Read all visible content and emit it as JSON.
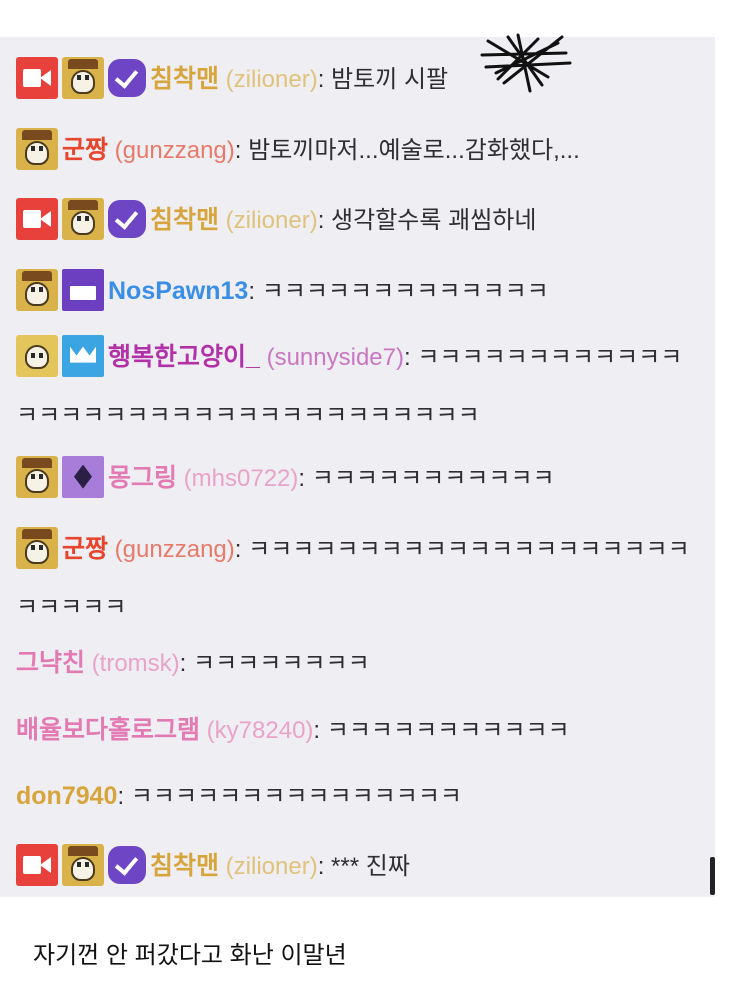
{
  "chat": {
    "messages": [
      {
        "badges": [
          "camera-icon",
          "skull-badge-icon",
          "verified-icon"
        ],
        "name": "침착맨",
        "login": "(zilioner)",
        "name_color": "#d8a53d",
        "text": "밤토끼 시팔",
        "sep": ": "
      },
      {
        "badges": [
          "skull-badge-icon"
        ],
        "name": "군짱",
        "login": "(gunzzang)",
        "name_color": "#e8452f",
        "login_color": "#e87a6a",
        "text": "밤토끼마저...예술로...감화했다,...",
        "sep": ": "
      },
      {
        "badges": [
          "camera-icon",
          "skull-badge-icon",
          "verified-icon"
        ],
        "name": "침착맨",
        "login": "(zilioner)",
        "name_color": "#d8a53d",
        "text": "생각할수록 괘씸하네",
        "sep": ": "
      },
      {
        "badges": [
          "skull-badge-icon",
          "subscriber-purple-icon"
        ],
        "name": "NosPawn13",
        "login": "",
        "name_color": "#3a8ee6",
        "text": "ㅋㅋㅋㅋㅋㅋㅋㅋㅋㅋㅋㅋㅋ",
        "sep": ": "
      },
      {
        "badges": [
          "skull-badge-icon",
          "crown-badge-icon"
        ],
        "name": "행복한고양이_",
        "login": "(sunnyside7)",
        "name_color": "#b331a8",
        "login_color": "#c977c2",
        "text": "ㅋㅋㅋㅋㅋㅋㅋㅋㅋㅋㅋㅋㅋㅋㅋㅋㅋㅋㅋㅋㅋㅋㅋㅋㅋㅋㅋㅋㅋㅋㅋㅋㅋ",
        "sep": ": "
      },
      {
        "badges": [
          "skull-badge-icon",
          "gem-badge-icon"
        ],
        "name": "몽그링",
        "login": "(mhs0722)",
        "name_color": "#e37ab3",
        "login_color": "#eaa3c8",
        "text": "ㅋㅋㅋㅋㅋㅋㅋㅋㅋㅋㅋ",
        "sep": ": "
      },
      {
        "badges": [
          "skull-badge-icon"
        ],
        "name": "군짱",
        "login": "(gunzzang)",
        "name_color": "#e8452f",
        "login_color": "#e87a6a",
        "text": "ㅋㅋㅋㅋㅋㅋㅋㅋㅋㅋㅋㅋㅋㅋㅋㅋㅋㅋㅋㅋㅋㅋㅋㅋㅋ",
        "sep": ": "
      },
      {
        "badges": [],
        "name": "그냑친",
        "login": "(tromsk)",
        "name_color": "#e37ab3",
        "login_color": "#eaa3c8",
        "text": "ㅋㅋㅋㅋㅋㅋㅋㅋ",
        "sep": ": "
      },
      {
        "badges": [],
        "name": "배율보다홀로그램",
        "login": "(ky78240)",
        "name_color": "#e37ab3",
        "login_color": "#eaa3c8",
        "text": "ㅋㅋㅋㅋㅋㅋㅋㅋㅋㅋㅋ",
        "sep": ": "
      },
      {
        "badges": [],
        "name": "don7940",
        "login": "",
        "name_color": "#d8a53d",
        "text": "ㅋㅋㅋㅋㅋㅋㅋㅋㅋㅋㅋㅋㅋㅋㅋ",
        "sep": ": "
      },
      {
        "badges": [
          "camera-icon",
          "skull-badge-icon",
          "verified-icon"
        ],
        "name": "침착맨",
        "login": "(zilioner)",
        "name_color": "#d8a53d",
        "text": "*** 진짜",
        "sep": ": "
      }
    ]
  },
  "caption": "자기껀 안 퍼갔다고 화난 이말년",
  "colors": {
    "chat_bg": "#efeef2",
    "text": "#2f2f33",
    "page_bg": "#ffffff"
  }
}
